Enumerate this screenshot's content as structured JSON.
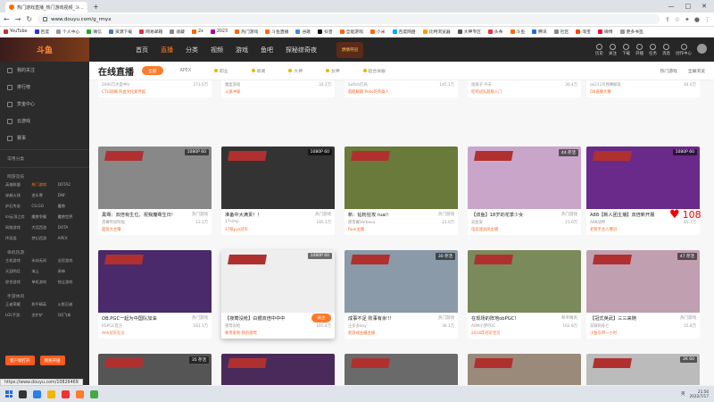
{
  "browser": {
    "tab_title": "热门游戏直播_热门游戏视频_斗...",
    "url": "www.douyu.com/g_rmyx",
    "bookmarks": [
      "YouTube",
      "百度",
      "个人中心",
      "微信",
      "资源下载",
      "网易邮箱",
      "收藏",
      "2x",
      "2023",
      "热门游戏",
      "斗鱼直播",
      "谷歌",
      "抖音",
      "全能游戏",
      "小米",
      "百度网盘",
      "比特浏览器",
      "大神专区",
      "头条",
      "斗鱼",
      "腾讯",
      "社区",
      "淘宝",
      "微博",
      "更多书签"
    ]
  },
  "header": {
    "logo": "斗鱼",
    "nav": [
      "首页",
      "直播",
      "分类",
      "视频",
      "游戏",
      "鱼吧",
      "探秘综奇夜"
    ],
    "active_nav": "直播",
    "badge": "燃情夺冠",
    "right_items": [
      "历史",
      "关注",
      "下载",
      "开播",
      "任务",
      "消息",
      "创作中心"
    ]
  },
  "sidebar": {
    "items": [
      "我的关注",
      "排行榜",
      "赏金中心",
      "云游戏",
      "赛事"
    ],
    "section_all": "常用分类",
    "section_online": "网游竞技",
    "online_games": [
      "英雄联盟",
      "热门游戏",
      "DOTA2",
      "穿越火线",
      "逆水寒",
      "DNF",
      "炉石传说",
      "CS:GO",
      "魔兽",
      "lol云顶之弈",
      "魔兽争霸",
      "魔兽世界",
      "网络游戏",
      "大话西游",
      "DOTA",
      "传奇类",
      "梦幻西游",
      "APEX"
    ],
    "section_single": "单机热游",
    "single_games": [
      "主机游戏",
      "永劫无间",
      "全民游戏",
      "天涯明月",
      "海上",
      "原神",
      "综合游戏",
      "单机游戏",
      "独立游戏"
    ],
    "section_mobile": "手游休闲",
    "mobile_games": [
      "王者荣耀",
      "和平精英",
      "火影忍者",
      "LOL手游",
      "金铲铲",
      "QQ飞车"
    ],
    "btn_left": "客户端打开",
    "btn_right": "我要开播"
  },
  "page": {
    "title": "在线直播",
    "filters": [
      "全部",
      "APEX",
      "职业",
      "新闻",
      "大神",
      "女神",
      "超合体跟"
    ],
    "active_filter": "全部",
    "right_links": [
      "热门游戏",
      "全屏浏览"
    ]
  },
  "cards": [
    {
      "title": "【1条回卡帕金牌】青青姐姐",
      "cat": "热门游戏",
      "user": "2000万才是中V",
      "viewers": "273.6万",
      "tag": "CTG斑斓 热血文化爱伴娱"
    },
    {
      "title": "[魔盒]【KD五百强帮队】可等可退",
      "cat": "热门游戏",
      "user": "魔盒游戏",
      "viewers": "32.2万",
      "tag": "火速冲锋"
    },
    {
      "title": "连拼小猫一下~",
      "cat": "热门游戏",
      "user": "Sefish灯光",
      "viewers": "145.1万",
      "tag": "超能解题 Peko的英雄人"
    },
    {
      "title": "小着同学六点半再来啦",
      "cat": "和平精英",
      "user": "雨滴子 今天",
      "viewers": "30.4万",
      "tag": "吃鸡战队超级入门"
    },
    {
      "title": "粗暴211~号obPGC~",
      "cat": "和平精英",
      "user": "ok211号预赛解说",
      "viewers": "44.6万",
      "tag": "OB直播大赛"
    },
    {
      "title": "黑骞：双倍有生位，祝我魔骞生日!",
      "cat": "热门游戏",
      "user": "黑骞传说阿福",
      "viewers": "13.1万",
      "tag": "超快大主播",
      "label": "1080P 60"
    },
    {
      "title": "准备中大满贯！！",
      "cat": "热门游戏",
      "user": "17simp",
      "viewers": "185.1万",
      "tag": "37级pyz冠军",
      "label": "1080P 60"
    },
    {
      "title": "新：钻粉狂攻 ruai！",
      "cat": "热门游戏",
      "user": "肥雪翼Verbosa",
      "viewers": "21.0万",
      "tag": "Ruai主播",
      "label": ""
    },
    {
      "title": "【双鱼】18岁的花季少女",
      "cat": "热门游戏",
      "user": "双鱼安",
      "viewers": "21.0万",
      "tag": "电竞迷战风主播",
      "label": "44 存活"
    },
    {
      "title": "A88【新人团主播】双倍新开服",
      "cat": "",
      "user": "A88战神",
      "viewers": "85.7万",
      "tag": "老帮不主人爆冠",
      "label": "1080P 60"
    },
    {
      "title": "OB.PGC一起为中国队加油",
      "cat": "热门游戏",
      "user": "RSPGC官方",
      "viewers": "181.1万",
      "tag": "Ahh冠军在尖",
      "label": ""
    },
    {
      "title": "【夜莺没枪】白银双倍中中中",
      "cat": "热门游戏",
      "user": "夜莺没枪",
      "viewers": "165.4万",
      "tag": "尊贵来到 我的夜莺",
      "label": "1080P 60"
    },
    {
      "title": "成事不足 败事有余'!!",
      "cat": "热门游戏",
      "user": "王多多ony",
      "viewers": "36.1万",
      "tag": "新游戏主播主播",
      "label": "30 存活"
    },
    {
      "title": "在现场的阵地obPGC!",
      "cat": "和平精英",
      "user": "ARM小梦PGC",
      "viewers": "162.8万",
      "tag": "2018年冠军宝贝",
      "label": ""
    },
    {
      "title": "【冠式英武】三三来随",
      "cat": "热门游戏",
      "user": "双微的冬七",
      "viewers": "55.8万",
      "tag": "小鱼东带一小时",
      "label": "47 存活"
    },
    {
      "label": "35 存活"
    },
    {
      "label": ""
    },
    {
      "label": ""
    },
    {
      "label": ""
    },
    {
      "label": "2K 60"
    }
  ],
  "follow_button": "关注",
  "gift_count": "108",
  "status_url": "https://www.douyu.com/10826469",
  "taskbar": {
    "time": "21:56",
    "date": "2022/7/17",
    "lang": "英"
  },
  "colors": {
    "accent": "#ff7a2a",
    "header": "#262626",
    "sidebar": "#2b2b2b"
  }
}
